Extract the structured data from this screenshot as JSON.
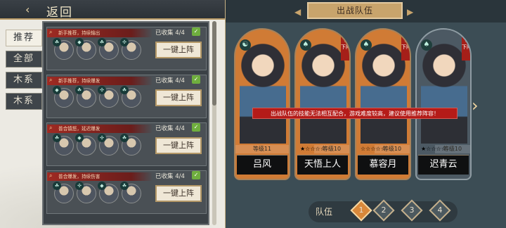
{
  "header": {
    "back_label": "返回",
    "title": "出战队伍"
  },
  "tabs": [
    {
      "label": "推荐",
      "active": true
    },
    {
      "label": "全部"
    },
    {
      "label": "木系"
    },
    {
      "label": "木系"
    }
  ],
  "recommendations": [
    {
      "title": "新手推荐，持续输出",
      "collected": "已收集 4/4",
      "button": "一键上阵"
    },
    {
      "title": "新手推荐，持续爆发",
      "collected": "已收集 4/4",
      "button": "一键上阵"
    },
    {
      "title": "普合镇怒，延迟爆发",
      "collected": "已收集 4/4",
      "button": "一键上阵"
    },
    {
      "title": "普合爆发，持续伤害",
      "collected": "已收集 4/4",
      "button": "一键上阵"
    }
  ],
  "cards": [
    {
      "name": "吕风",
      "level": "等级11",
      "remove": "",
      "stars": ""
    },
    {
      "name": "天悟上人",
      "level": "等级10",
      "remove": "下阵",
      "stars": "★☆☆☆☆"
    },
    {
      "name": "慕容月",
      "level": "等级10",
      "remove": "下阵",
      "stars": "☆☆☆☆☆"
    },
    {
      "name": "迟青云",
      "level": "等级10",
      "remove": "下阵",
      "stars": "★☆☆☆☆"
    }
  ],
  "tip": "出战队伍的技能无法相互配合，游戏难度较高，建议使用推荐阵容！",
  "team": {
    "label": "队伍",
    "slots": [
      "1",
      "2",
      "3",
      "4"
    ]
  },
  "colors": {
    "accent": "#b51b18",
    "gold": "#c8a46c"
  }
}
